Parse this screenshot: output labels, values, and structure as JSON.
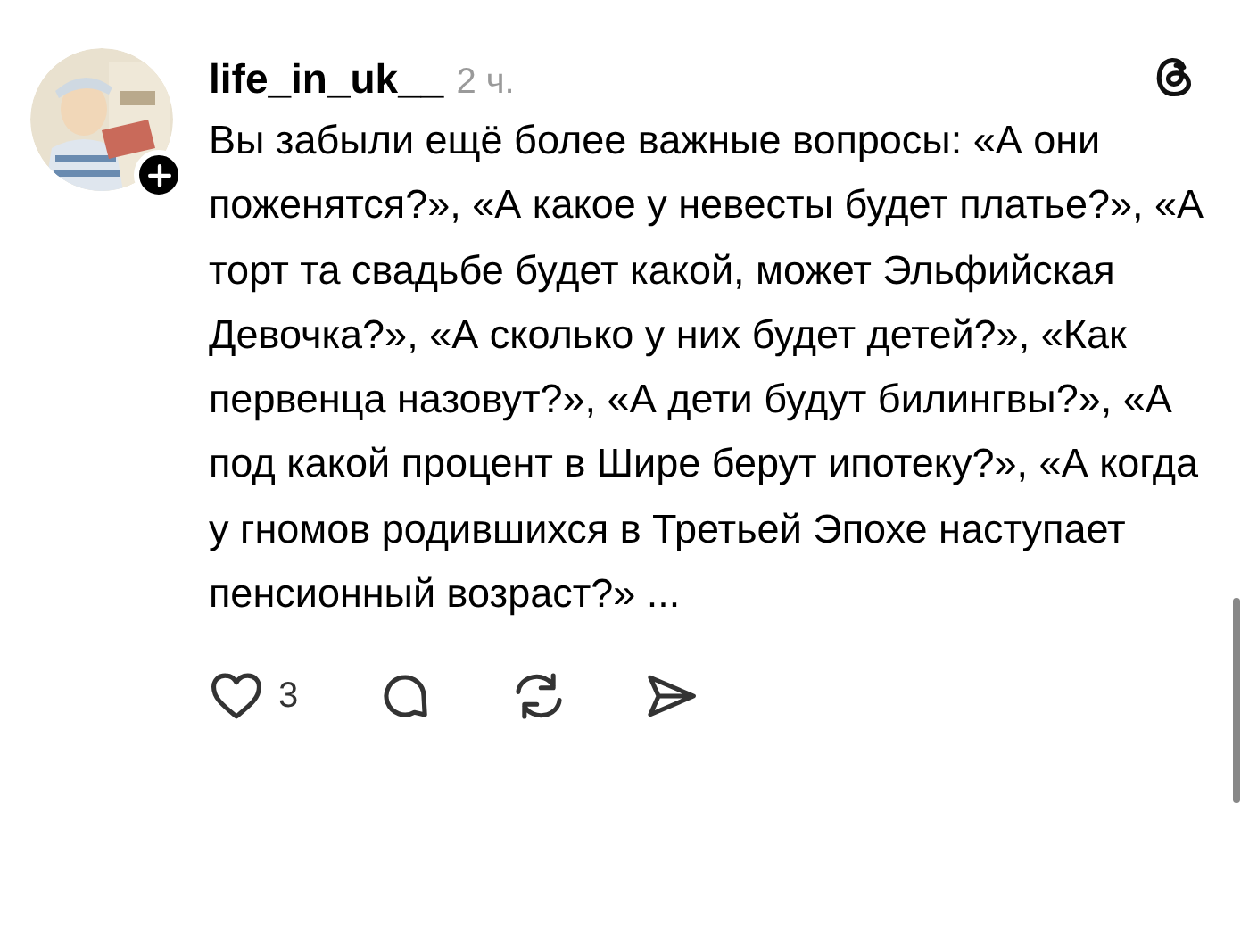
{
  "post": {
    "username": "life_in_uk__",
    "time": "2 ч.",
    "text": "Вы забыли ещё более важные вопросы: «А они поженятся?», «А какое у невесты будет платье?», «А торт та свадьбе будет какой, может Эльфийская Девочка?», «А сколько у них будет детей?», «Как первенца назовут?», «А дети будут билингвы?», «А под какой процент в Шире берут ипотеку?», «А когда у гномов родившихся в Третьей Эпохе наступает пенсионный возраст?» ...",
    "likes": "3",
    "liked": false
  }
}
